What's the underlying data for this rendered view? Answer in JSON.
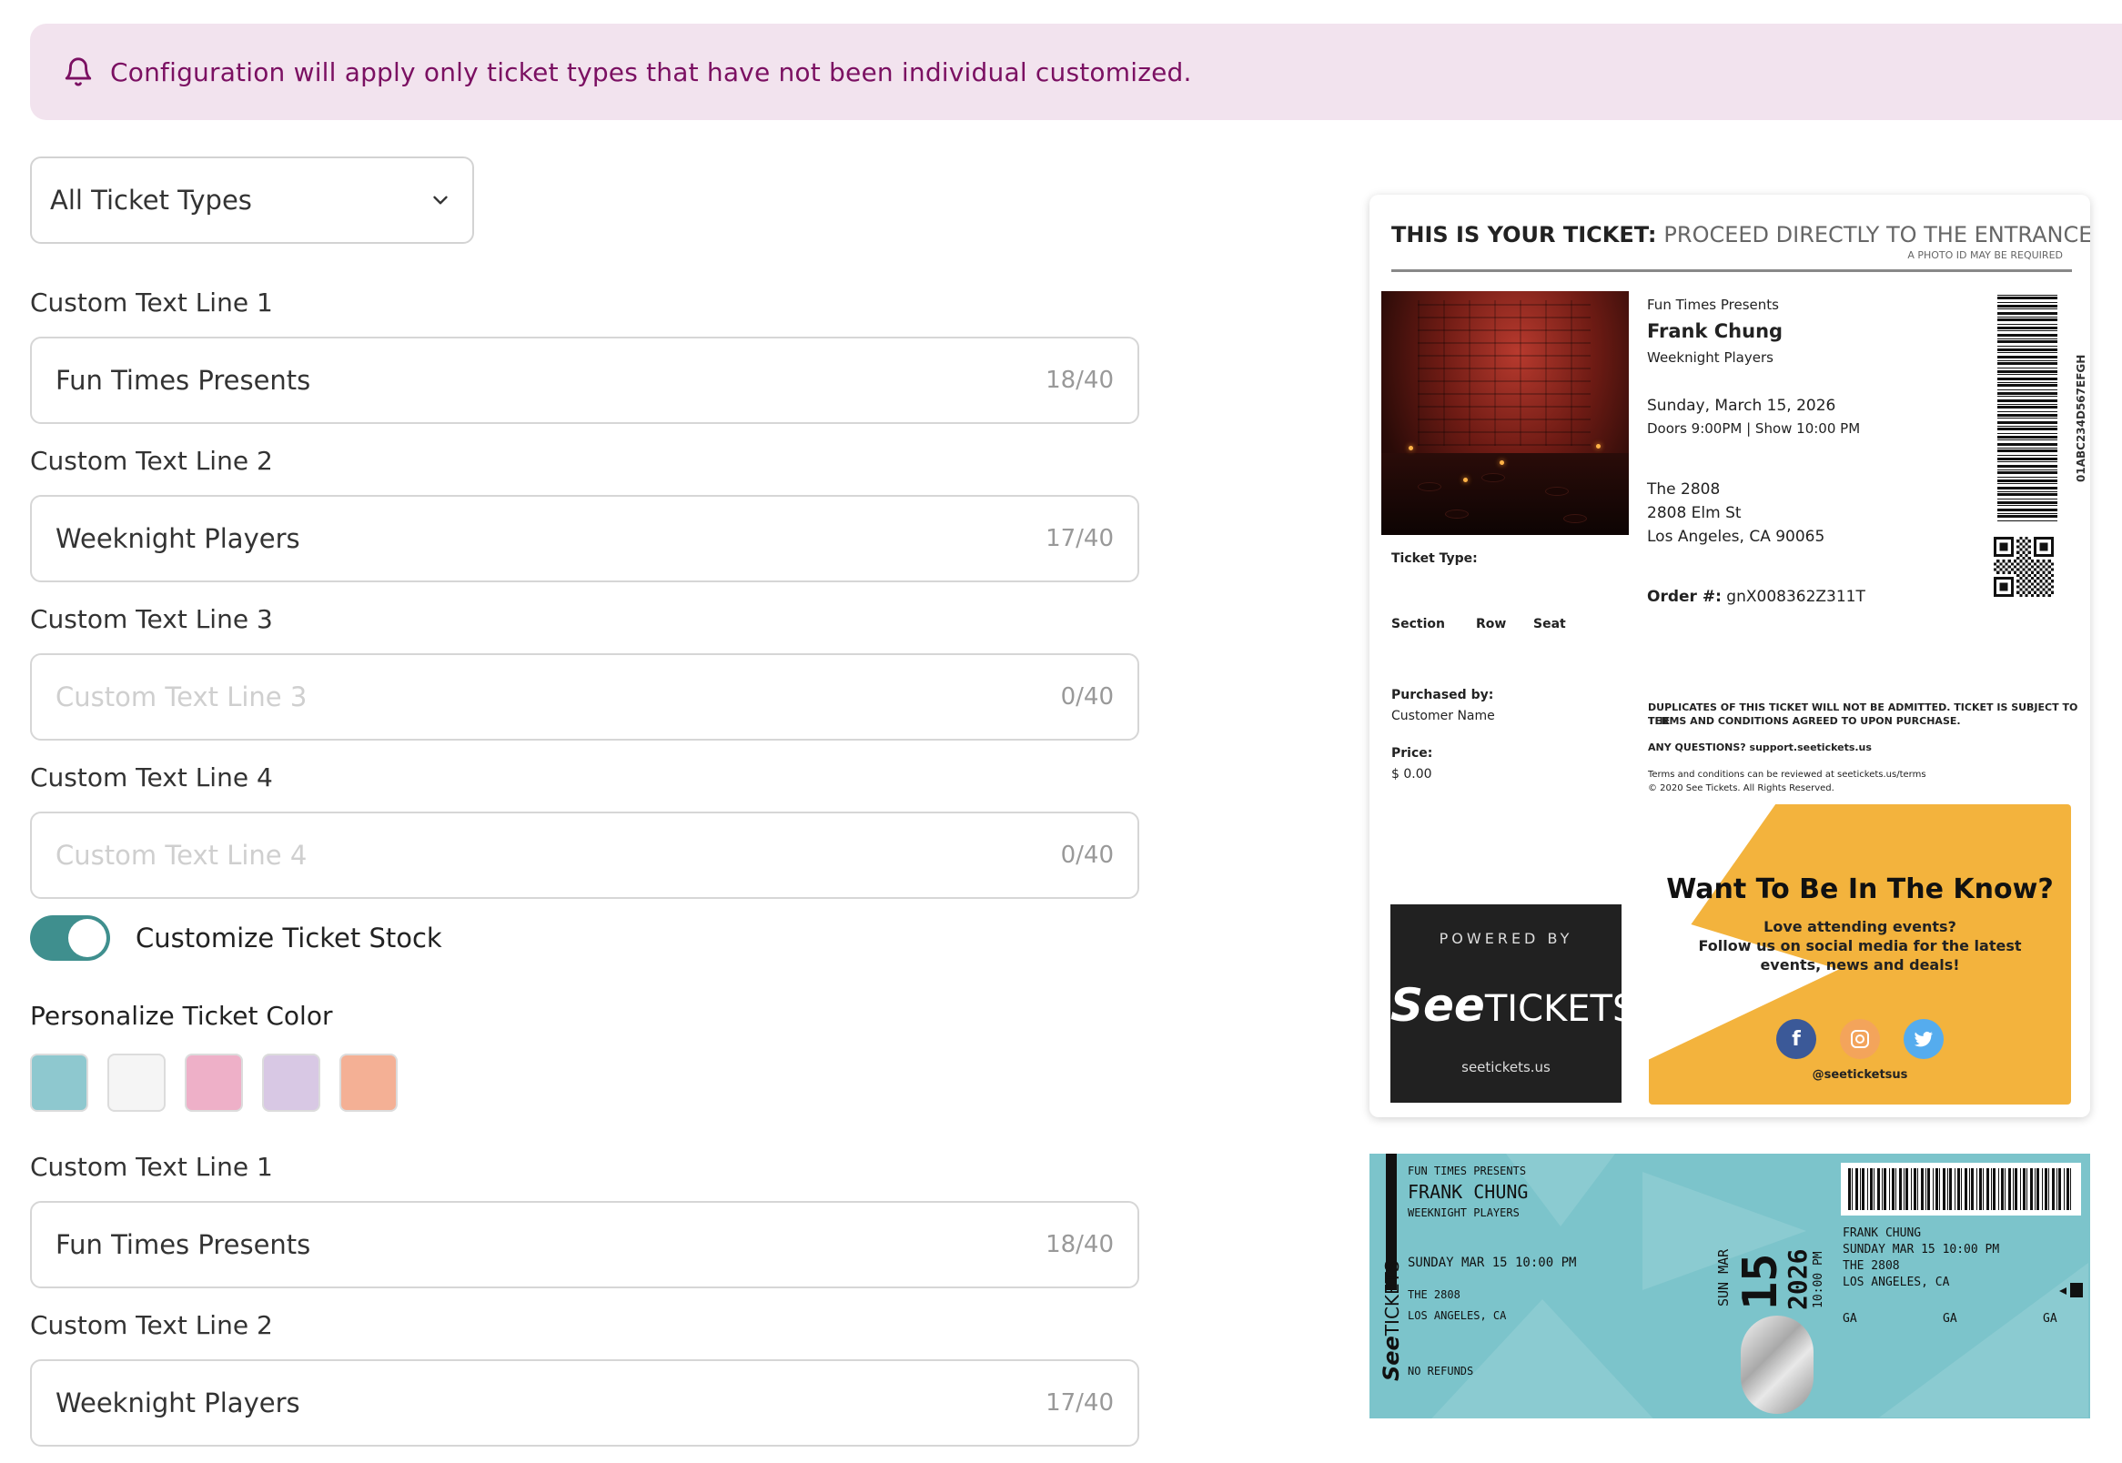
{
  "banner": {
    "message": "Configuration will apply only ticket types that have not been individual customized."
  },
  "ticket_type_select": {
    "value": "All Ticket Types"
  },
  "form_top": [
    {
      "label": "Custom Text Line 1",
      "value": "Fun Times Presents",
      "placeholder": "",
      "count": "18/40"
    },
    {
      "label": "Custom Text Line 2",
      "value": "Weeknight Players",
      "placeholder": "",
      "count": "17/40"
    },
    {
      "label": "Custom Text Line 3",
      "value": "",
      "placeholder": "Custom Text Line 3",
      "count": "0/40"
    },
    {
      "label": "Custom Text Line 4",
      "value": "",
      "placeholder": "Custom Text Line 4",
      "count": "0/40"
    }
  ],
  "toggle": {
    "label": "Customize Ticket Stock",
    "on": true
  },
  "color_section": {
    "label": "Personalize Ticket Color",
    "colors": [
      "#8ec8cf",
      "#f5f5f5",
      "#eeb0c8",
      "#d8c8e4",
      "#f4b095"
    ]
  },
  "form_bottom": [
    {
      "label": "Custom Text Line 1",
      "value": "Fun Times Presents",
      "count": "18/40"
    },
    {
      "label": "Custom Text Line 2",
      "value": "Weeknight Players",
      "count": "17/40"
    }
  ],
  "ticket": {
    "header_bold": "THIS IS YOUR TICKET:",
    "header_light": "PROCEED DIRECTLY TO THE ENTRANCE",
    "photo_note": "A PHOTO ID MAY BE REQUIRED",
    "presenter": "Fun Times Presents",
    "name": "Frank Chung",
    "group": "Weeknight Players",
    "date": "Sunday, March 15, 2026",
    "times": "Doors 9:00PM | Show 10:00 PM",
    "venue": "The 2808",
    "street": "2808 Elm St",
    "city": "Los Angeles, CA 90065",
    "ticket_type_label": "Ticket Type:",
    "order_label": "Order #:",
    "order_value": "gnX008362Z311T",
    "section_label": "Section",
    "row_label": "Row",
    "seat_label": "Seat",
    "purchased_label": "Purchased by:",
    "purchased_value": "Customer Name",
    "price_label": "Price:",
    "price_value": "$ 0.00",
    "vertical_code": "01ABC234D567EFGH",
    "legal_1": "DUPLICATES OF THIS TICKET WILL NOT BE ADMITTED. TICKET IS SUBJECT TO THE",
    "legal_2": "TERMS AND CONDITIONS AGREED TO UPON PURCHASE.",
    "legal_3": "ANY QUESTIONS? support.seetickets.us",
    "legal_4": "Terms and conditions can be reviewed at seetickets.us/terms",
    "legal_5": "© 2020 See Tickets. All Rights Reserved.",
    "promo_title": "Want To Be In The Know?",
    "promo_line1": "Love attending events?",
    "promo_line2": "Follow us on social media for the latest",
    "promo_line3": "events, news and deals!",
    "promo_handle": "@seeticketsus",
    "powered_by": "POWERED BY",
    "logo_see": "See",
    "logo_tickets": "TICKETS",
    "logo_url": "seetickets.us"
  },
  "stock": {
    "presenter": "FUN TIMES PRESENTS",
    "name": "FRANK CHUNG",
    "group": "WEEKNIGHT PLAYERS",
    "datetime": "SUNDAY MAR 15 10:00 PM",
    "venue": "THE 2808",
    "city": "LOS ANGELES, CA",
    "refunds": "NO REFUNDS",
    "day_month": "SUN MAR",
    "day": "15",
    "year": "2026",
    "time": "10:00 PM",
    "stub_name": "FRANK CHUNG",
    "stub_datetime": "SUNDAY MAR 15 10:00 PM",
    "stub_venue": "THE 2808",
    "stub_city": "LOS ANGELES, CA",
    "ga_1": "GA",
    "ga_2": "GA",
    "ga_3": "GA",
    "logo_see": "See",
    "logo_tickets": "TICKETS"
  }
}
